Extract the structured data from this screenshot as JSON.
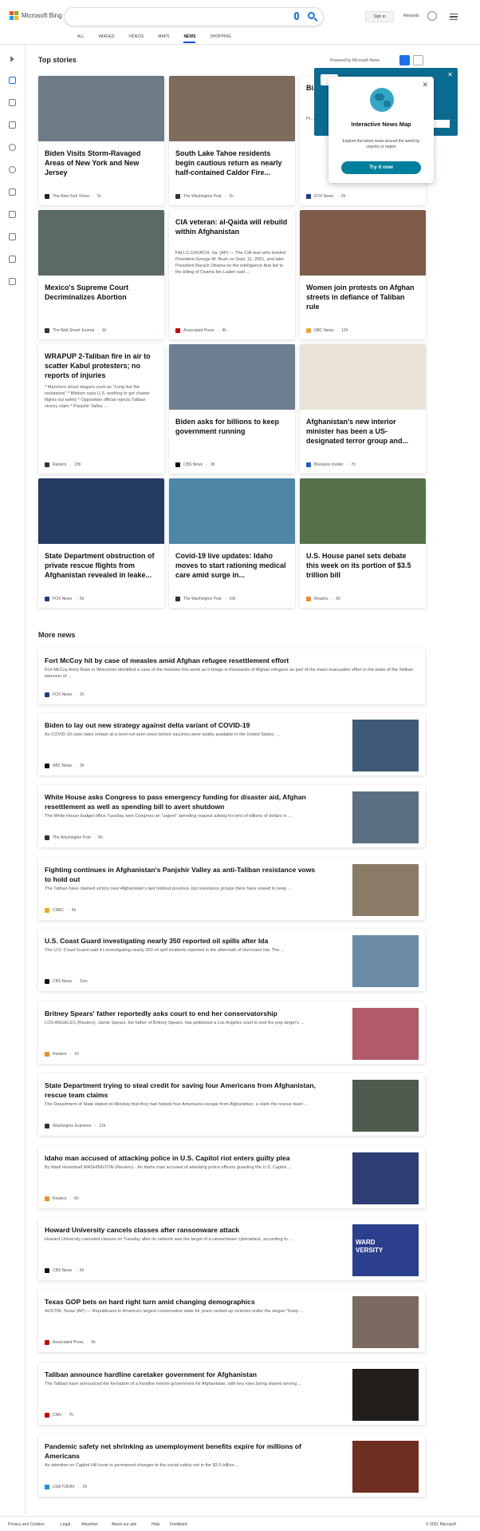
{
  "header": {
    "brand": "Microsoft Bing",
    "signin": "Sign in",
    "rewards": "Rewards"
  },
  "tabs": [
    "ALL",
    "IMAGES",
    "VIDEOS",
    "MAPS",
    "NEWS",
    "SHOPPING"
  ],
  "sections": {
    "top": "Top stories",
    "more": "More news"
  },
  "powered_by": "Powered by Microsoft News",
  "popup": {
    "title": "Interactive News Map",
    "desc": "Explore the latest news around the world by country or region",
    "button": "Try it now"
  },
  "cards": [
    {
      "title": "Biden Visits Storm-Ravaged Areas of New York and New Jersey",
      "source": "The New York Times",
      "time": "1h",
      "img": "#6f7b84",
      "fav": "#222"
    },
    {
      "title": "South Lake Tahoe residents begin cautious return as nearly half-contained Caldor Fire...",
      "source": "The Washington Post",
      "time": "1h",
      "img": "#7d6b5c",
      "fav": "#333"
    },
    {
      "title": "Bi... w... st...",
      "snippet": "Pr... shoute... from A... actuall... sugges...",
      "source": "FOX News",
      "time": "2h",
      "img": "",
      "fav": "#1c3b8f"
    },
    {
      "title": "Mexico's Supreme Court Decriminalizes Abortion",
      "source": "The Wall Street Journal",
      "time": "1h",
      "img": "#5b6a63",
      "fav": "#333"
    },
    {
      "title": "CIA veteran: al-Qaida will rebuild within Afghanistan",
      "snippet": "FALLS CHURCH, Va. (AP) — The CIA man who briefed President George W. Bush on Sept. 11, 2001, and later President Barack Obama on the intelligence that led to the killing of Osama bin Laden said ...",
      "source": "Associated Press",
      "time": "4h",
      "img": "",
      "fav": "#c00"
    },
    {
      "title": "Women join protests on Afghan streets in defiance of Taliban rule",
      "source": "NBC News",
      "time": "12h",
      "img": "#7e5a4a",
      "fav": "#f5a623"
    },
    {
      "title": "WRAPUP 2-Taliban fire in air to scatter Kabul protesters; no reports of injuries",
      "snippet": "* Marchers shout slogans such as \"Long live the resistance\" * Blinken says U.S. working to get charter flights out safely * Opposition official rejects Taliban victory claim * Panjshir Valley ...",
      "source": "Reuters",
      "time": "15h",
      "img": "",
      "fav": "#333"
    },
    {
      "title": "Biden asks for billions to keep government running",
      "source": "CBS News",
      "time": "3h",
      "img": "#6d7f91",
      "fav": "#111"
    },
    {
      "title": "Afghanistan's new interior minister has been a US-designated terror group and...",
      "source": "Business Insider",
      "time": "7h",
      "img": "#e9e2d6",
      "fav": "#1f5fbf"
    },
    {
      "title": "State Department obstruction of private rescue flights from Afghanistan revealed in leake...",
      "source": "FOX News",
      "time": "5h",
      "img": "#243a5e",
      "fav": "#1c3b8f"
    },
    {
      "title": "Covid-19 live updates: Idaho moves to start rationing medical care amid surge in...",
      "source": "The Washington Post",
      "time": "16h",
      "img": "#4d86a6",
      "fav": "#333"
    },
    {
      "title": "U.S. House panel sets debate this week on its portion of $3.5 trillion bill",
      "source": "Reuters",
      "time": "6h",
      "img": "#56704a",
      "fav": "#f08c2e"
    }
  ],
  "news": [
    {
      "title": "Fort McCoy hit by case of measles amid Afghan refugee resettlement effort",
      "snippet": "Fort McCoy Army Base in Wisconsin identified a case of the measles this week as it brings in thousands of Afghan refugees as part of the mass evacuation effort in the wake of the Taliban takeover of ...",
      "source": "FOX News",
      "time": "2h",
      "fav": "#1c3b8f"
    },
    {
      "title": "Biden to lay out new strategy against delta variant of COVID-19",
      "snippet": "As COVID-19 case rates remain at a level not seen since before vaccines were widely available in the United States, ...",
      "source": "ABC News",
      "time": "3h",
      "fav": "#111",
      "img": "#3f5a78"
    },
    {
      "title": "White House asks Congress to pass emergency funding for disaster aid, Afghan resettlement as well as spending bill to avert shutdown",
      "snippet": "The White House budget office Tuesday sent Congress an \"urgent\" spending request asking for tens of billions of dollars in ...",
      "source": "The Washington Post",
      "time": "6h",
      "fav": "#333",
      "img": "#5a6f82"
    },
    {
      "title": "Fighting continues in Afghanistan's Panjshir Valley as anti-Taliban resistance vows to hold out",
      "snippet": "The Taliban have claimed victory over Afghanistan's last holdout province, but resistance groups there have vowed to keep ...",
      "source": "CNBC",
      "time": "6h",
      "fav": "#f5a623",
      "img": "#8a7b66"
    },
    {
      "title": "U.S. Coast Guard investigating nearly 350 reported oil spills after Ida",
      "snippet": "The U.S. Coast Guard said it's investigating nearly 350 oil spill incidents reported in the aftermath of Hurricane Ida. The ...",
      "source": "CBS News",
      "time": "31m",
      "fav": "#111",
      "img": "#6b8aa3"
    },
    {
      "title": "Britney Spears' father reportedly asks court to end her conservatorship",
      "snippet": "LOS ANGELES (Reuters) -Jamie Spears, the father of Britney Spears, has petitioned a Los Angeles court to end the pop singer's ...",
      "source": "Reuters",
      "time": "1h",
      "fav": "#f08c2e",
      "img": "#b05a6a"
    },
    {
      "title": "State Department trying to steal credit for saving four Americans from Afghanistan, rescue team claims",
      "snippet": "The Department of State stated on Monday that they had helped four Americans escape from Afghanistan, a claim the rescue team ...",
      "source": "Washington Examiner",
      "time": "11h",
      "fav": "#333",
      "img": "#4f5a4e"
    },
    {
      "title": "Idaho man accused of attacking police in U.S. Capitol riot enters guilty plea",
      "snippet": "By Mark Hosenball WASHINGTON (Reuters) - An Idaho man accused of attacking police officers guarding the U.S. Capitol ...",
      "source": "Reuters",
      "time": "6h",
      "fav": "#f08c2e",
      "img": "#2e3e74"
    },
    {
      "title": "Howard University cancels classes after ransomware attack",
      "snippet": "Howard University canceled classes on Tuesday after its network was the target of a ransomware cyberattack, according to ...",
      "source": "CBS News",
      "time": "6h",
      "fav": "#111",
      "img": "#2c3f8c",
      "sign": "WARD VERSITY"
    },
    {
      "title": "Texas GOP bets on hard right turn amid changing demographics",
      "snippet": "AUSTIN, Texas (AP) — Republicans in America's largest conservative state for years racked up victories under the slogan \"Keep ...",
      "source": "Associated Press",
      "time": "5h",
      "fav": "#c00",
      "img": "#7a6a60"
    },
    {
      "title": "Taliban announce hardline caretaker government for Afghanistan",
      "snippet": "The Taliban have announced the formation of a hardline interim government for Afghanistan, with key roles being shared among ...",
      "source": "CNN",
      "time": "7h",
      "fav": "#c00",
      "img": "#221e1c"
    },
    {
      "title": "Pandemic safety net shrinking as unemployment benefits expire for millions of Americans",
      "snippet": "As attention on Capitol Hill turns to permanent changes to the social safety net in the $3.5 trillion ...",
      "source": "USA TODAY",
      "time": "2h",
      "fav": "#1f8ee6",
      "img": "#6e2e22"
    }
  ],
  "footer": {
    "links": [
      "Privacy and Cookies",
      "Legal",
      "Advertise",
      "About our ads",
      "Help",
      "Feedback"
    ],
    "copyright": "© 2021 Microsoft"
  }
}
